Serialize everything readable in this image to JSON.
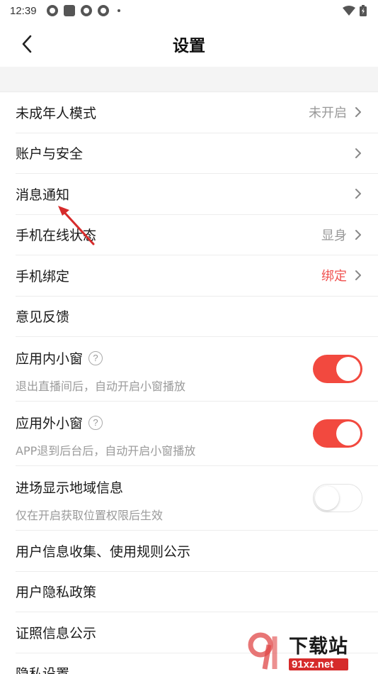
{
  "status_bar": {
    "time": "12:39",
    "icons": [
      "app-circle-icon",
      "stop-square-icon",
      "app-circle-icon",
      "app-circle-icon",
      "dot-icon"
    ],
    "right_icons": [
      "wifi-icon",
      "battery-icon"
    ]
  },
  "header": {
    "title": "设置",
    "back_icon": "chevron-left-icon"
  },
  "settings": {
    "minor_mode": {
      "label": "未成年人模式",
      "value": "未开启"
    },
    "account_security": {
      "label": "账户与安全"
    },
    "notifications": {
      "label": "消息通知"
    },
    "online_status": {
      "label": "手机在线状态",
      "value": "显身"
    },
    "phone_binding": {
      "label": "手机绑定",
      "value": "绑定",
      "value_color": "#f0504f"
    },
    "feedback": {
      "label": "意见反馈"
    },
    "in_app_window": {
      "label": "应用内小窗",
      "sub": "退出直播间后，自动开启小窗播放",
      "toggle": "on"
    },
    "out_app_window": {
      "label": "应用外小窗",
      "sub": "APP退到后台后，自动开启小窗播放",
      "toggle": "on"
    },
    "region_info": {
      "label": "进场显示地域信息",
      "sub": "仅在开启获取位置权限后生效",
      "toggle": "off"
    },
    "info_rules": {
      "label": "用户信息收集、使用规则公示"
    },
    "privacy_policy": {
      "label": "用户隐私政策"
    },
    "license_info": {
      "label": "证照信息公示"
    },
    "privacy_settings": {
      "label": "隐私设置"
    }
  },
  "help_glyph": "?",
  "watermark": {
    "title": "下载站",
    "url": "91xz.net"
  },
  "colors": {
    "accent": "#f2493f",
    "red_text": "#f0504f",
    "annotation": "#d62b2b"
  }
}
